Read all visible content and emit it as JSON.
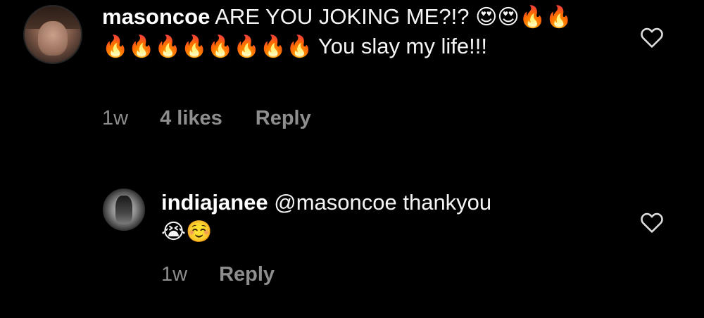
{
  "comment": {
    "username": "masoncoe",
    "text_part1": "ARE YOU JOKING ME?!? ",
    "emojis_line": "😍😍🔥🔥🔥🔥🔥🔥🔥🔥🔥🔥",
    "text_part2": " You slay my life!!!",
    "time": "1w",
    "likes": "4 likes",
    "reply_label": "Reply"
  },
  "reply": {
    "username": "indiajanee",
    "mention": "@masoncoe",
    "text": " thankyou",
    "emojis": "😭☺️",
    "time": "1w",
    "reply_label": "Reply"
  },
  "icons": {
    "like": "heart-outline-icon",
    "avatar_main": "avatar",
    "avatar_reply": "avatar"
  },
  "colors": {
    "background": "#000000",
    "text": "#ffffff",
    "meta": "#8e8e8e",
    "icon": "#dbdbdb"
  }
}
